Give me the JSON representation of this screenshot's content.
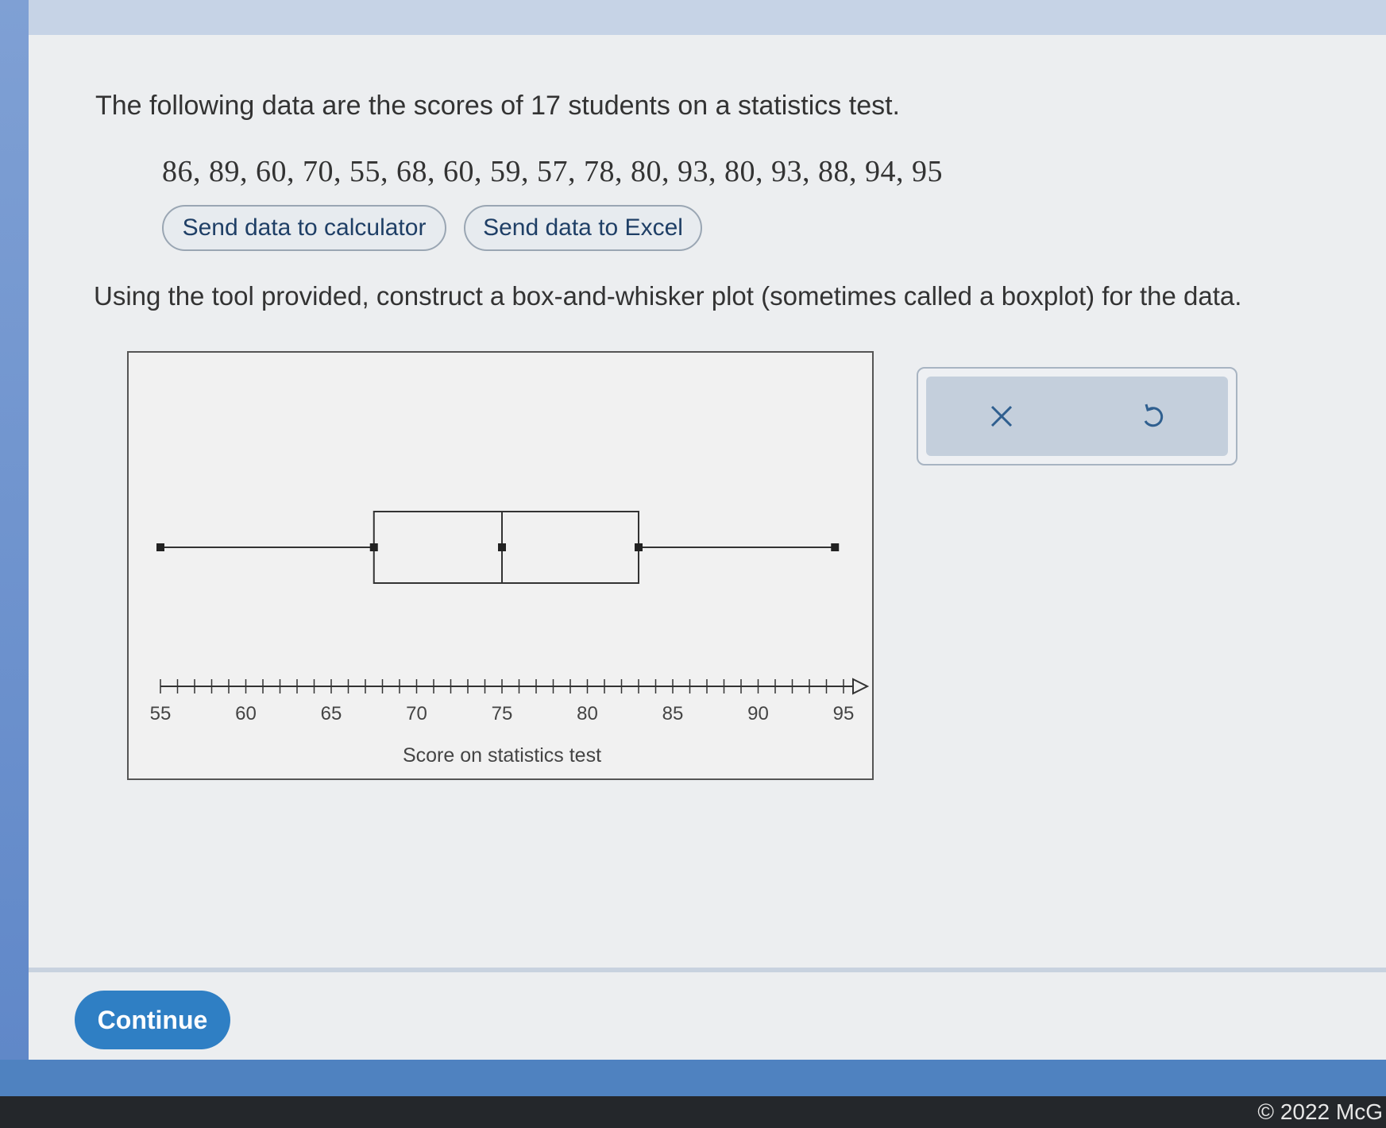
{
  "problem": {
    "intro": "The following data are the scores of 17 students on a statistics test.",
    "data_values": "86, 89, 60, 70, 55, 68, 60, 59, 57, 78, 80, 93, 80, 93, 88, 94, 95",
    "send_calculator_label": "Send data to calculator",
    "send_excel_label": "Send data to Excel",
    "instruction": "Using the tool provided, construct a box-and-whisker plot (sometimes called a boxplot) for the data."
  },
  "chart_data": {
    "type": "boxplot",
    "xlabel": "Score on statistics test",
    "xlim": [
      55,
      95
    ],
    "ticks": [
      55,
      60,
      65,
      70,
      75,
      80,
      85,
      90,
      95
    ],
    "minor_tick_step": 1,
    "boxplot": {
      "min": 55,
      "q1": 67.5,
      "median": 75,
      "q3": 83,
      "max": 94.5
    }
  },
  "tools": {
    "clear_icon": "close-icon",
    "undo_icon": "undo-icon"
  },
  "footer": {
    "continue_label": "Continue",
    "copyright": "© 2022 McG"
  },
  "colors": {
    "continue_button": "#2f7fc4",
    "page_background": "#eceef0",
    "accent_blue": "#4f82c0"
  }
}
